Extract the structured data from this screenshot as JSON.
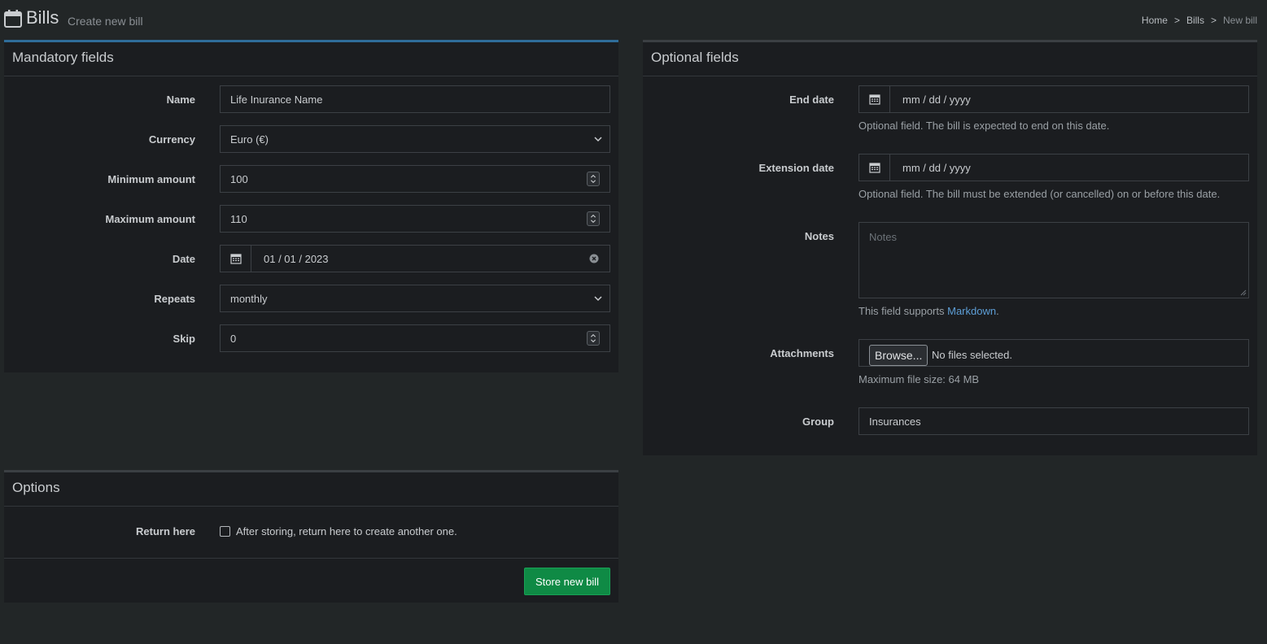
{
  "header": {
    "title": "Bills",
    "subtitle": "Create new bill",
    "breadcrumb": [
      "Home",
      "Bills",
      "New bill"
    ],
    "breadcrumb_sep": ">"
  },
  "mandatory": {
    "title": "Mandatory fields",
    "name": {
      "label": "Name",
      "value": "Life Inurance Name"
    },
    "currency": {
      "label": "Currency",
      "value": "Euro (€)"
    },
    "min_amount": {
      "label": "Minimum amount",
      "value": "100"
    },
    "max_amount": {
      "label": "Maximum amount",
      "value": "110"
    },
    "date": {
      "label": "Date",
      "value": "01 / 01 / 2023"
    },
    "repeats": {
      "label": "Repeats",
      "value": "monthly"
    },
    "skip": {
      "label": "Skip",
      "value": "0"
    }
  },
  "optional": {
    "title": "Optional fields",
    "end_date": {
      "label": "End date",
      "placeholder": "mm / dd / yyyy",
      "help": "Optional field. The bill is expected to end on this date."
    },
    "extension_date": {
      "label": "Extension date",
      "placeholder": "mm / dd / yyyy",
      "help": "Optional field. The bill must be extended (or cancelled) on or before this date."
    },
    "notes": {
      "label": "Notes",
      "placeholder": "Notes",
      "help_prefix": "This field supports ",
      "help_link": "Markdown",
      "help_suffix": "."
    },
    "attachments": {
      "label": "Attachments",
      "button": "Browse...",
      "status": "No files selected.",
      "help": "Maximum file size: 64 MB"
    },
    "group": {
      "label": "Group",
      "value": "Insurances"
    }
  },
  "options": {
    "title": "Options",
    "return_here": {
      "label": "Return here",
      "text": "After storing, return here to create another one.",
      "checked": false
    },
    "submit": "Store new bill"
  },
  "icons": {
    "header": "calendar-icon",
    "date_addon": "calendar-icon",
    "select": "chevron-down-icon",
    "number": "spinner-icon",
    "clear": "clear-icon"
  },
  "colors": {
    "primary_border": "#2f6d99",
    "submit_bg": "#0f8a45",
    "link": "#5d9ed6"
  }
}
